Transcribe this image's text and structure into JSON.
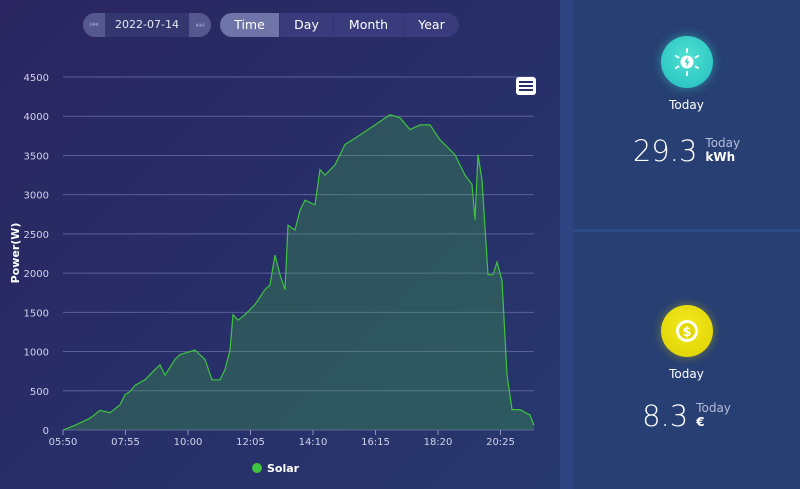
{
  "toolbar": {
    "date": "2022-07-14",
    "prev_icon": "skip-back-icon",
    "next_icon": "skip-forward-icon",
    "tabs": [
      {
        "label": "Time",
        "active": true
      },
      {
        "label": "Day",
        "active": false
      },
      {
        "label": "Month",
        "active": false
      },
      {
        "label": "Year",
        "active": false
      }
    ]
  },
  "chart_data": {
    "type": "area",
    "title": "",
    "xlabel": "",
    "ylabel": "Power(W)",
    "x_unit": "minutes since midnight",
    "xlim": [
      350,
      1292
    ],
    "ylim": [
      0,
      4500
    ],
    "grid": true,
    "yticks": [
      0,
      500,
      1000,
      1500,
      2000,
      2500,
      3000,
      3500,
      4000,
      4500
    ],
    "xticks": [
      {
        "v": 350,
        "label": "05:50"
      },
      {
        "v": 475,
        "label": "07:55"
      },
      {
        "v": 600,
        "label": "10:00"
      },
      {
        "v": 725,
        "label": "12:05"
      },
      {
        "v": 850,
        "label": "14:10"
      },
      {
        "v": 975,
        "label": "16:15"
      },
      {
        "v": 1100,
        "label": "18:20"
      },
      {
        "v": 1225,
        "label": "20:25"
      }
    ],
    "legend": {
      "position": "bottom",
      "entries": [
        "Solar"
      ]
    },
    "series": [
      {
        "name": "Solar",
        "color": "#3ec43e",
        "x": [
          350,
          374,
          404,
          424,
          444,
          464,
          474,
          484,
          494,
          514,
          534,
          544,
          554,
          574,
          584,
          604,
          614,
          624,
          634,
          648,
          664,
          674,
          684,
          690,
          700,
          714,
          734,
          754,
          764,
          774,
          784,
          794,
          800,
          814,
          824,
          834,
          854,
          864,
          874,
          894,
          914,
          944,
          974,
          1004,
          1024,
          1044,
          1064,
          1084,
          1104,
          1134,
          1154,
          1168,
          1174,
          1180,
          1188,
          1200,
          1210,
          1218,
          1228,
          1238,
          1248,
          1264,
          1284,
          1292
        ],
        "values": [
          0,
          60,
          150,
          250,
          220,
          320,
          450,
          490,
          570,
          640,
          770,
          830,
          700,
          900,
          960,
          1000,
          1020,
          960,
          900,
          640,
          640,
          770,
          1020,
          1470,
          1400,
          1470,
          1600,
          1790,
          1850,
          2230,
          1980,
          1790,
          2610,
          2550,
          2800,
          2930,
          2870,
          3320,
          3250,
          3380,
          3640,
          3760,
          3890,
          4020,
          3980,
          3830,
          3890,
          3890,
          3700,
          3510,
          3250,
          3130,
          2680,
          3510,
          3190,
          1980,
          1980,
          2140,
          1910,
          700,
          260,
          260,
          190,
          60
        ]
      }
    ],
    "menu_icon": "hamburger-menu-icon"
  },
  "cards": [
    {
      "icon": "sun-energy-icon",
      "label": "Today",
      "value": "29.3",
      "sub_label": "Today",
      "unit": "kWh",
      "color": "#2cc7bf"
    },
    {
      "icon": "dollar-coin-icon",
      "label": "Today",
      "value": "8.3",
      "sub_label": "Today",
      "unit": "€",
      "color": "#e3d800"
    }
  ]
}
